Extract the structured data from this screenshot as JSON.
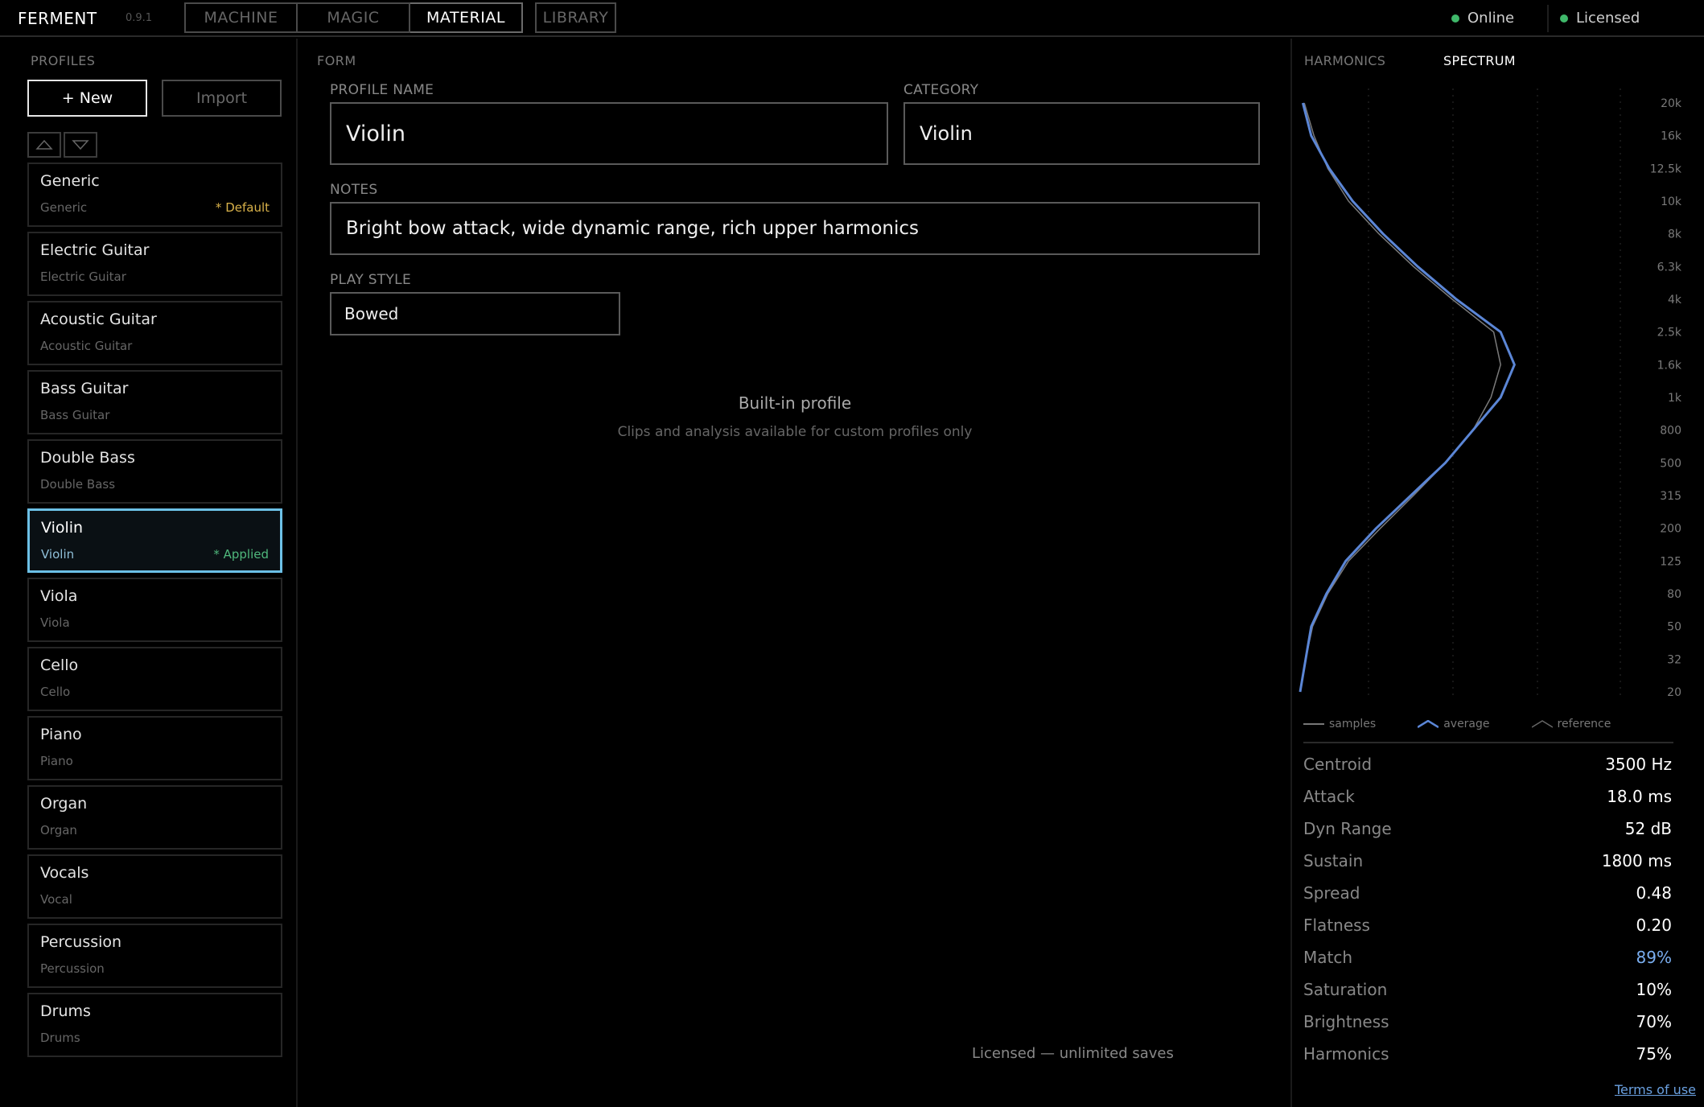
{
  "app": {
    "name": "FERMENT",
    "version": "0.9.1"
  },
  "tabs": [
    {
      "label": "MACHINE"
    },
    {
      "label": "MAGIC"
    },
    {
      "label": "MATERIAL"
    },
    {
      "label": "LIBRARY"
    }
  ],
  "status": {
    "online": "Online",
    "licensed": "Licensed",
    "dot_color": "#3fb86a"
  },
  "profiles": {
    "section_label": "PROFILES",
    "new_label": "+ New",
    "import_label": "Import",
    "items": [
      {
        "name": "Generic",
        "category": "Generic",
        "tag": "* Default"
      },
      {
        "name": "Electric Guitar",
        "category": "Electric Guitar",
        "tag": ""
      },
      {
        "name": "Acoustic Guitar",
        "category": "Acoustic Guitar",
        "tag": ""
      },
      {
        "name": "Bass Guitar",
        "category": "Bass Guitar",
        "tag": ""
      },
      {
        "name": "Double Bass",
        "category": "Double Bass",
        "tag": ""
      },
      {
        "name": "Violin",
        "category": "Violin",
        "tag": "* Applied"
      },
      {
        "name": "Viola",
        "category": "Viola",
        "tag": ""
      },
      {
        "name": "Cello",
        "category": "Cello",
        "tag": ""
      },
      {
        "name": "Piano",
        "category": "Piano",
        "tag": ""
      },
      {
        "name": "Organ",
        "category": "Organ",
        "tag": ""
      },
      {
        "name": "Vocals",
        "category": "Vocal",
        "tag": ""
      },
      {
        "name": "Percussion",
        "category": "Percussion",
        "tag": ""
      },
      {
        "name": "Drums",
        "category": "Drums",
        "tag": ""
      }
    ]
  },
  "form": {
    "section_label": "FORM",
    "profile_name_label": "PROFILE NAME",
    "profile_name": "Violin",
    "category_label": "CATEGORY",
    "category": "Violin",
    "notes_label": "NOTES",
    "notes": "Bright bow attack, wide dynamic range, rich upper harmonics",
    "play_style_label": "PLAY STYLE",
    "play_style": "Bowed",
    "builtin_title": "Built-in profile",
    "builtin_sub": "Clips and analysis available for custom profiles only",
    "license_note": "Licensed — unlimited saves"
  },
  "analysis": {
    "tab_harmonics": "HARMONICS",
    "tab_spectrum": "SPECTRUM",
    "legend": {
      "samples": "samples",
      "average": "average",
      "reference": "reference"
    },
    "colors": {
      "average": "#5b86d6",
      "reference": "#7a7a7a"
    },
    "metrics": [
      {
        "label": "Centroid",
        "value": "3500 Hz"
      },
      {
        "label": "Attack",
        "value": "18.0 ms"
      },
      {
        "label": "Dyn Range",
        "value": "52 dB"
      },
      {
        "label": "Sustain",
        "value": "1800 ms"
      },
      {
        "label": "Spread",
        "value": "0.48"
      },
      {
        "label": "Flatness",
        "value": "0.20"
      },
      {
        "label": "Match",
        "value": "89%"
      },
      {
        "label": "Saturation",
        "value": "10%"
      },
      {
        "label": "Brightness",
        "value": "70%"
      },
      {
        "label": "Harmonics",
        "value": "75%"
      }
    ],
    "terms_label": "Terms of use"
  },
  "chart_data": {
    "type": "line",
    "orientation": "horizontal-magnitude",
    "categories": [
      "20",
      "32",
      "50",
      "80",
      "125",
      "200",
      "315",
      "500",
      "800",
      "1k",
      "1.6k",
      "2.5k",
      "4k",
      "6.3k",
      "8k",
      "10k",
      "12.5k",
      "16k",
      "20k"
    ],
    "series": [
      {
        "name": "average",
        "values": [
          0.0,
          0.04,
          0.08,
          0.19,
          0.33,
          0.55,
          0.8,
          1.05,
          1.25,
          1.45,
          1.55,
          1.45,
          1.13,
          0.85,
          0.6,
          0.38,
          0.21,
          0.08,
          0.02
        ]
      },
      {
        "name": "reference",
        "values": [
          0.0,
          0.04,
          0.09,
          0.2,
          0.35,
          0.58,
          0.82,
          1.05,
          1.25,
          1.38,
          1.45,
          1.4,
          1.1,
          0.82,
          0.57,
          0.35,
          0.2,
          0.1,
          0.03
        ]
      }
    ],
    "xlim": [
      0,
      1.6
    ],
    "grid": true,
    "legend": "bottom"
  }
}
